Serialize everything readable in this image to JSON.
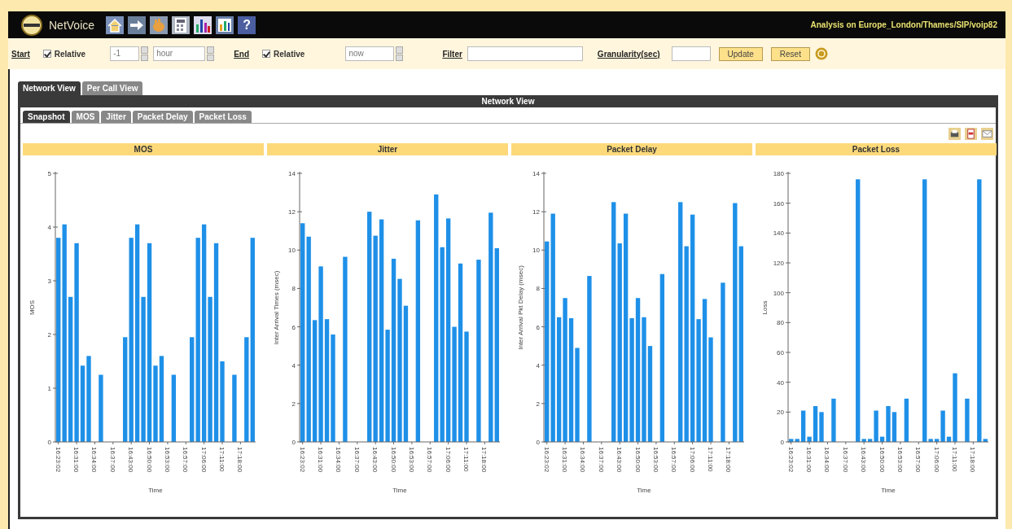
{
  "header": {
    "app_name": "NetVoice",
    "help_icon": "?",
    "context": "Analysis on Europe_London/Thames/SIP/voip82"
  },
  "toolbar": {
    "start_label": "Start",
    "start_relative": {
      "label": "Relative",
      "checked": true
    },
    "start_amount": "-1",
    "start_unit": "hour",
    "end_label": "End",
    "end_relative": {
      "label": "Relative",
      "checked": true
    },
    "end_value": "now",
    "filter_label": "Filter",
    "granularity_label": "Granularity(sec)",
    "buttons": [
      "Update",
      "Reset"
    ]
  },
  "view_tabs": [
    {
      "label": "Network View",
      "selected": true
    },
    {
      "label": "Per Call View",
      "selected": false
    }
  ],
  "panel_title": "Network View",
  "sub_tabs": [
    {
      "label": "Snapshot",
      "selected": true
    },
    {
      "label": "MOS",
      "selected": false
    },
    {
      "label": "Jitter",
      "selected": false
    },
    {
      "label": "Packet Delay",
      "selected": false
    },
    {
      "label": "Packet Loss",
      "selected": false
    }
  ],
  "charts": [
    {
      "title": "MOS",
      "chart_data": {
        "type": "bar",
        "xlabel": "Time",
        "ylabel": "MOS",
        "ylim": [
          0,
          5
        ],
        "yticks": [
          0,
          1,
          2,
          3,
          4,
          5
        ],
        "categories": [
          "16:23:02",
          null,
          null,
          "16:31:00",
          null,
          null,
          "16:34:00",
          null,
          null,
          "16:37:00",
          null,
          null,
          "16:43:00",
          null,
          null,
          "16:50:00",
          null,
          null,
          "16:53:00",
          null,
          null,
          "16:57:00",
          null,
          null,
          "17:06:00",
          null,
          null,
          "17:11:00",
          null,
          null,
          "17:18:00",
          null,
          null
        ],
        "series": [
          {
            "color": "#1e90e8",
            "values": [
              3.8,
              4.05,
              2.7,
              3.7,
              1.42,
              1.6,
              null,
              1.25,
              null,
              null,
              null,
              1.95,
              3.8,
              4.05,
              2.7,
              3.7,
              1.42,
              1.6,
              null,
              1.25,
              null,
              null,
              1.95,
              3.8,
              4.05,
              2.7,
              3.7,
              1.5,
              null,
              1.25,
              null,
              1.95,
              3.8
            ]
          }
        ]
      }
    },
    {
      "title": "Jitter",
      "chart_data": {
        "type": "bar",
        "xlabel": "Time",
        "ylabel": "Inter Arrival Times (msec)",
        "ylim": [
          0,
          14
        ],
        "yticks": [
          0,
          2,
          4,
          6,
          8,
          10,
          12,
          14
        ],
        "categories": [
          "16:23:02",
          null,
          null,
          "16:31:00",
          null,
          null,
          "16:34:00",
          null,
          null,
          "16:37:00",
          null,
          null,
          "16:43:00",
          null,
          null,
          "16:50:00",
          null,
          null,
          "16:53:00",
          null,
          null,
          "16:57:00",
          null,
          null,
          "17:06:00",
          null,
          null,
          "17:11:00",
          null,
          null,
          "17:18:00",
          null,
          null
        ],
        "series": [
          {
            "color": "#1e90e8",
            "values": [
              11.4,
              10.7,
              6.35,
              9.15,
              6.4,
              5.6,
              null,
              9.65,
              null,
              null,
              null,
              12.0,
              10.75,
              11.6,
              5.85,
              9.55,
              8.5,
              7.1,
              null,
              11.55,
              null,
              null,
              12.9,
              10.15,
              11.65,
              6.0,
              9.3,
              5.75,
              null,
              9.5,
              null,
              11.95,
              10.1
            ]
          }
        ]
      }
    },
    {
      "title": "Packet Delay",
      "chart_data": {
        "type": "bar",
        "xlabel": "Time",
        "ylabel": "Inter Arrival Pkt Delay (msec)",
        "ylim": [
          0,
          14
        ],
        "yticks": [
          0,
          2,
          4,
          6,
          8,
          10,
          12,
          14
        ],
        "categories": [
          "16:23:02",
          null,
          null,
          "16:31:00",
          null,
          null,
          "16:34:00",
          null,
          null,
          "16:37:00",
          null,
          null,
          "16:43:00",
          null,
          null,
          "16:50:00",
          null,
          null,
          "16:53:00",
          null,
          null,
          "16:57:00",
          null,
          null,
          "17:06:00",
          null,
          null,
          "17:11:00",
          null,
          null,
          "17:18:00",
          null,
          null
        ],
        "series": [
          {
            "color": "#1e90e8",
            "values": [
              10.45,
              11.9,
              6.5,
              7.5,
              6.45,
              4.9,
              null,
              8.65,
              null,
              null,
              null,
              12.5,
              10.35,
              11.9,
              6.45,
              7.5,
              6.5,
              5.0,
              null,
              8.75,
              null,
              null,
              12.5,
              10.2,
              11.85,
              6.4,
              7.45,
              5.45,
              null,
              8.3,
              null,
              12.45,
              10.2
            ]
          }
        ]
      }
    },
    {
      "title": "Packet Loss",
      "chart_data": {
        "type": "bar",
        "xlabel": "Time",
        "ylabel": "Loss",
        "ylim": [
          0,
          180
        ],
        "yticks": [
          0,
          20,
          40,
          60,
          80,
          100,
          120,
          140,
          160,
          180
        ],
        "categories": [
          "16:23:02",
          null,
          null,
          "16:31:00",
          null,
          null,
          "16:34:00",
          null,
          null,
          "16:37:00",
          null,
          null,
          "16:43:00",
          null,
          null,
          "16:50:00",
          null,
          null,
          "16:53:00",
          null,
          null,
          "16:57:00",
          null,
          null,
          "17:06:00",
          null,
          null,
          "17:11:00",
          null,
          null,
          "17:18:00",
          null,
          null
        ],
        "series": [
          {
            "color": "#1e90e8",
            "values": [
              2,
              2,
              21,
              3.5,
              24,
              20,
              null,
              29,
              null,
              null,
              null,
              176,
              2,
              2,
              21,
              3.5,
              24,
              20,
              null,
              29,
              null,
              null,
              176,
              2,
              2,
              21,
              3.5,
              46,
              null,
              29,
              null,
              176,
              2
            ]
          }
        ]
      }
    }
  ]
}
